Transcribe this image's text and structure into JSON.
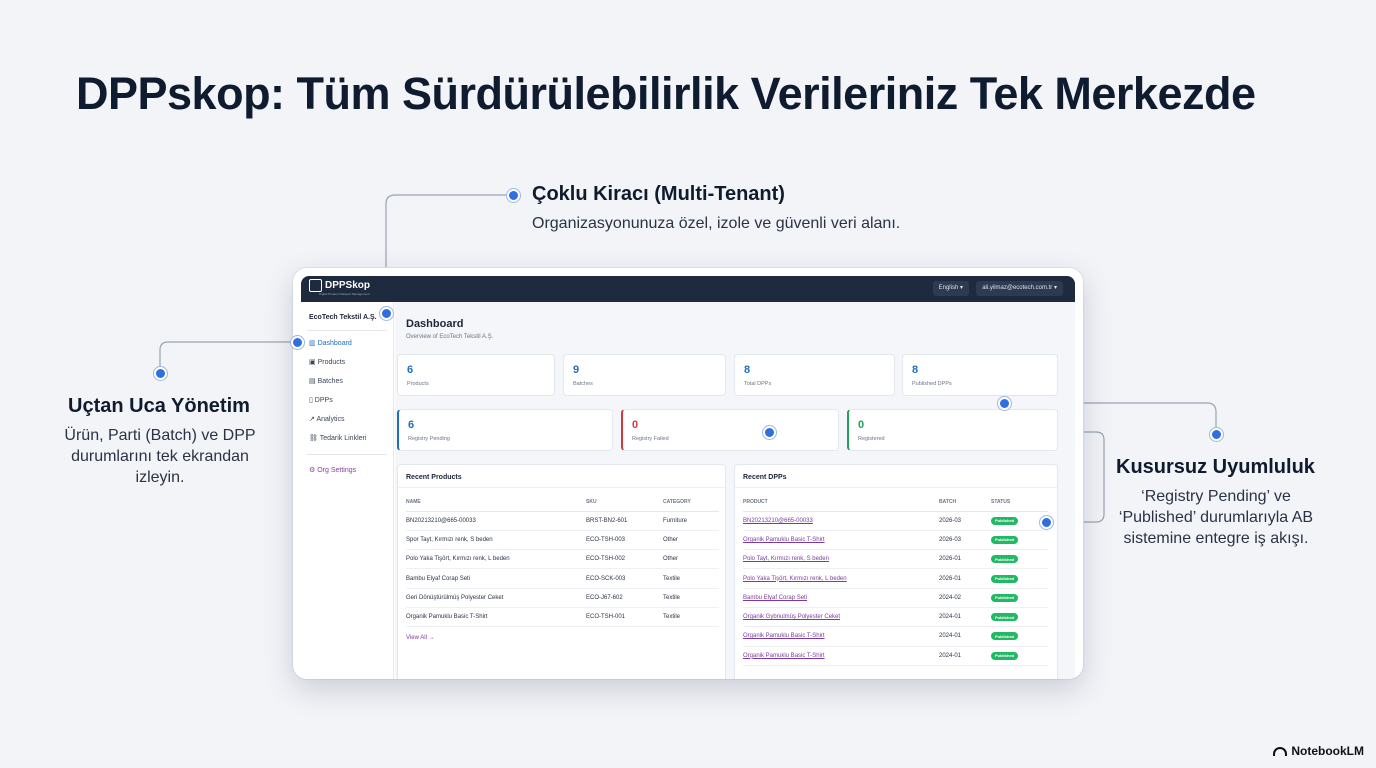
{
  "title": "DPPskop: Tüm Sürdürülebilirlik Verileriniz Tek Merkezde",
  "callouts": {
    "multi_tenant": {
      "title": "Çoklu Kiracı (Multi-Tenant)",
      "text": "Organizasyonunuza özel, izole ve güvenli veri alanı."
    },
    "end_to_end": {
      "title": "Uçtan Uca Yönetim",
      "text_lines": [
        "Ürün, Parti (Batch) ve DPP",
        "durumlarını tek ekrandan",
        "izleyin."
      ]
    },
    "compliance": {
      "title": "Kusursuz Uyumluluk",
      "text_lines": [
        "‘Registry Pending’ ve",
        "‘Published’ durumlarıyla AB",
        "sistemine entegre iş akışı."
      ]
    }
  },
  "app": {
    "logo": "DPPSkop",
    "logo_sub": "Digital Product Passport Management",
    "lang_select": "English",
    "user_select": "ali.yilmaz@ecotech.com.tr",
    "org_name": "EcoTech Tekstil A.Ş.",
    "nav": [
      "Dashboard",
      "Products",
      "Batches",
      "DPPs",
      "Analytics",
      "Tedarik Linkleri"
    ],
    "org_settings": "Org Settings",
    "dashboard_title": "Dashboard",
    "dashboard_sub": "Overview of EcoTech Tekstil A.Ş.",
    "stats": [
      {
        "value": "6",
        "label": "Products"
      },
      {
        "value": "9",
        "label": "Batches"
      },
      {
        "value": "8",
        "label": "Total DPPs"
      },
      {
        "value": "8",
        "label": "Published DPPs"
      }
    ],
    "registry": [
      {
        "value": "6",
        "label": "Registry Pending",
        "color": "#1f6fbf"
      },
      {
        "value": "0",
        "label": "Registry Failed",
        "color": "#d23a3a"
      },
      {
        "value": "0",
        "label": "Registered",
        "color": "#22a05a"
      }
    ],
    "recent_products": {
      "title": "Recent Products",
      "headers": [
        "NAME",
        "SKU",
        "CATEGORY"
      ],
      "rows": [
        [
          "BN20213210@665-00033",
          "BRST-BN2-601",
          "Furniture"
        ],
        [
          "Spor Tayt, Kırmızı renk, S beden",
          "ECO-TSH-003",
          "Other"
        ],
        [
          "Polo Yaka Tişört, Kırmızı renk, L beden",
          "ECO-TSH-002",
          "Other"
        ],
        [
          "Bambu Elyaf Corap Seti",
          "ECO-SCK-003",
          "Textile"
        ],
        [
          "Geri Dönüştürülmüş Polyester Ceket",
          "ECO-J67-602",
          "Textile"
        ],
        [
          "Organik Pamuklu Basic T-Shirt",
          "ECO-TSH-001",
          "Textile"
        ]
      ],
      "view_all": "View All →"
    },
    "recent_dpps": {
      "title": "Recent DPPs",
      "headers": [
        "PRODUCT",
        "BATCH",
        "STATUS"
      ],
      "rows": [
        [
          "BN20213210@665-00033",
          "2026-03",
          "Published"
        ],
        [
          "Organik Pamuklu Basic T-Shirt",
          "2026-03",
          "Published"
        ],
        [
          "Polo Tayt, Kırmızı renk, S beden",
          "2026-01",
          "Published"
        ],
        [
          "Polo Yaka Tişört, Kırmızı renk, L beden",
          "2026-01",
          "Published"
        ],
        [
          "Bambu Elyaf Corap Seti",
          "2024-02",
          "Published"
        ],
        [
          "Organik Gybnulmüş Polyester Ceket",
          "2024-01",
          "Published"
        ],
        [
          "Organik Pamuklu Basic T-Shirt",
          "2024-01",
          "Published"
        ],
        [
          "Organik Pamuklu Basic T-Shirt",
          "2024-01",
          "Published"
        ]
      ]
    }
  },
  "watermark": "NotebookLM"
}
